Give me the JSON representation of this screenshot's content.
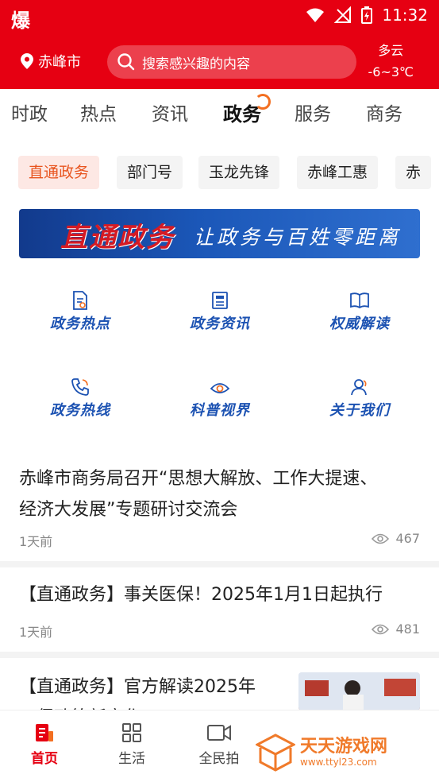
{
  "status_bar": {
    "app_label": "爆",
    "time": "11:32"
  },
  "header": {
    "location": "赤峰市",
    "search_placeholder": "搜索感兴趣的内容",
    "weather_condition": "多云",
    "weather_temp": "-6~3℃"
  },
  "tabs": [
    "时政",
    "热点",
    "资讯",
    "政务",
    "服务",
    "商务"
  ],
  "active_tab": "政务",
  "chips": [
    "直通政务",
    "部门号",
    "玉龙先锋",
    "赤峰工惠",
    "赤"
  ],
  "banner": {
    "title": "直通政务",
    "subtitle": "让政务与百姓零距离"
  },
  "grid": [
    {
      "label": "政务热点",
      "icon": "document-icon"
    },
    {
      "label": "政务资讯",
      "icon": "news-icon"
    },
    {
      "label": "权威解读",
      "icon": "book-icon"
    },
    {
      "label": "政务热线",
      "icon": "phone-icon"
    },
    {
      "label": "科普视界",
      "icon": "eye-cloud-icon"
    },
    {
      "label": "关于我们",
      "icon": "users-icon"
    }
  ],
  "articles": [
    {
      "title_line1": "赤峰市商务局召开“思想大解放、工作大提速、",
      "title_line2": "经济大发展”专题研讨交流会",
      "time": "1天前",
      "views": "467"
    },
    {
      "title_line1": "【直通政务】事关医保！2025年1月1日起执行",
      "time": "1天前",
      "views": "481"
    },
    {
      "title_line1": "【直通政务】官方解读2025年",
      "title_line2": "三保政策新变化"
    }
  ],
  "bottom_nav": [
    "首页",
    "生活",
    "全民拍"
  ],
  "watermark": {
    "title": "天天游戏网",
    "url": "www.ttyl23.com"
  },
  "colors": {
    "brand_red": "#e60012",
    "accent_orange": "#e8541e",
    "grid_blue": "#1c52b2"
  }
}
